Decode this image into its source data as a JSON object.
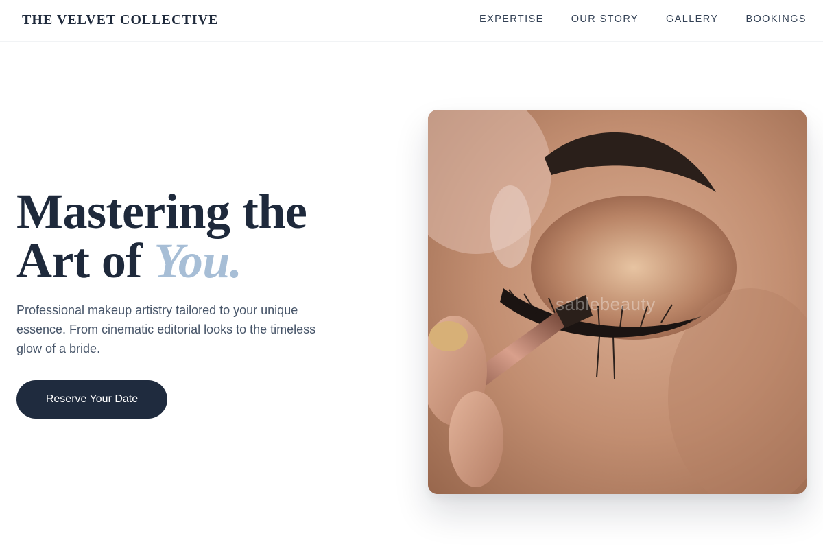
{
  "header": {
    "logo": "THE VELVET COLLECTIVE",
    "nav": [
      "EXPERTISE",
      "OUR STORY",
      "GALLERY",
      "BOOKINGS"
    ]
  },
  "hero": {
    "title_line1": "Mastering the",
    "title_line2_prefix": "Art of ",
    "title_accent": "You.",
    "subtitle": "Professional makeup artistry tailored to your unique essence. From cinematic editorial looks to the timeless glow of a bride.",
    "cta_label": "Reserve Your Date",
    "image_watermark": "sablebeauty"
  },
  "colors": {
    "primary": "#1f2b3e",
    "accent": "#a7bed6",
    "text_muted": "#475569"
  }
}
